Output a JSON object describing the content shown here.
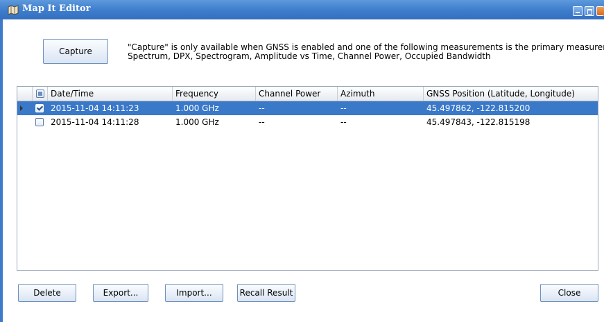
{
  "window": {
    "title": "Map It Editor"
  },
  "capture": {
    "label": "Capture",
    "info_line1": "\"Capture\" is only available when GNSS is enabled and one of the following measurements is the primary measurement:",
    "info_line2": "Spectrum, DPX, Spectrogram, Amplitude vs Time, Channel Power, Occupied Bandwidth"
  },
  "table": {
    "columns": [
      "Date/Time",
      "Frequency",
      "Channel Power",
      "Azimuth",
      "GNSS Position (Latitude, Longitude)"
    ],
    "rows": [
      {
        "datetime": "2015-11-04 14:11:23",
        "frequency": "1.000 GHz",
        "channel_power": "--",
        "azimuth": "--",
        "gnss": "45.497862, -122.815200",
        "checked": true,
        "selected": true
      },
      {
        "datetime": "2015-11-04 14:11:28",
        "frequency": "1.000 GHz",
        "channel_power": "--",
        "azimuth": "--",
        "gnss": "45.497843, -122.815198",
        "checked": false,
        "selected": false
      }
    ]
  },
  "buttons": {
    "delete": "Delete",
    "export": "Export...",
    "import": "Import...",
    "recall": "Recall Result",
    "close": "Close"
  },
  "colors": {
    "title_bar": "#3d7ccc",
    "selection": "#3a78c8"
  }
}
